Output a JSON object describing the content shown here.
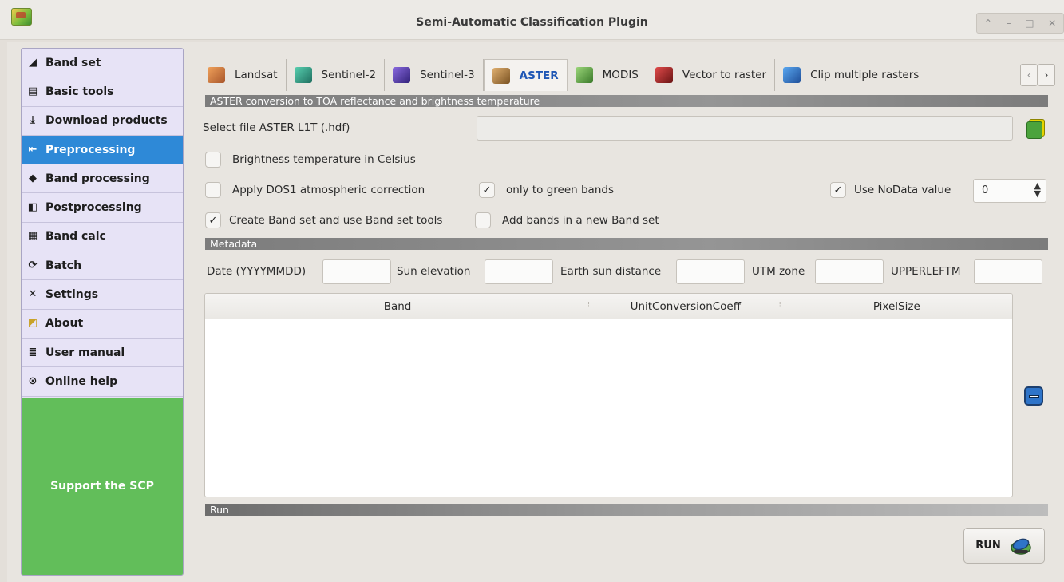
{
  "window": {
    "title": "Semi-Automatic Classification Plugin",
    "controls": [
      "⌃",
      "–",
      "□",
      "✕"
    ]
  },
  "sidebar": {
    "items": [
      {
        "label": "Band set",
        "icon": "band-set-icon"
      },
      {
        "label": "Basic tools",
        "icon": "basic-tools-icon"
      },
      {
        "label": "Download products",
        "icon": "download-icon"
      },
      {
        "label": "Preprocessing",
        "icon": "preprocessing-icon",
        "active": true
      },
      {
        "label": "Band processing",
        "icon": "band-processing-icon"
      },
      {
        "label": "Postprocessing",
        "icon": "postprocessing-icon"
      },
      {
        "label": "Band calc",
        "icon": "band-calc-icon"
      },
      {
        "label": "Batch",
        "icon": "batch-icon"
      },
      {
        "label": "Settings",
        "icon": "settings-icon"
      },
      {
        "label": "About",
        "icon": "about-icon"
      },
      {
        "label": "User manual",
        "icon": "user-manual-icon"
      },
      {
        "label": "Online help",
        "icon": "online-help-icon"
      }
    ],
    "support": "Support the SCP"
  },
  "tabs": [
    {
      "label": "Landsat",
      "color": "#d9894a"
    },
    {
      "label": "Sentinel-2",
      "color": "#3fb0a0"
    },
    {
      "label": "Sentinel-3",
      "color": "#6a4bc4"
    },
    {
      "label": "ASTER",
      "color": "#c08a4a",
      "active": true
    },
    {
      "label": "MODIS",
      "color": "#6aa84f"
    },
    {
      "label": "Vector to raster",
      "color": "#b03030"
    },
    {
      "label": "Clip multiple rasters",
      "color": "#2e7fd0"
    }
  ],
  "aster": {
    "group_title": "ASTER conversion to TOA reflectance and brightness temperature",
    "select_file_label": "Select file ASTER L1T (.hdf)",
    "file_value": "",
    "brightness_celsius": {
      "label": "Brightness temperature in Celsius",
      "checked": false
    },
    "dos1": {
      "label": "Apply DOS1 atmospheric correction",
      "checked": false
    },
    "green_bands": {
      "label": "only to green bands",
      "checked": true
    },
    "nodata": {
      "label": "Use NoData value",
      "checked": true,
      "value": "0"
    },
    "create_bandset": {
      "label": "Create Band set and use Band set tools",
      "checked": true
    },
    "add_bands": {
      "label": "Add bands in a new Band set",
      "checked": false
    }
  },
  "metadata": {
    "group_title": "Metadata",
    "date_label": "Date (YYYYMMDD)",
    "date_value": "",
    "sun_elevation_label": "Sun elevation",
    "sun_elevation_value": "",
    "earth_sun_label": "Earth sun distance",
    "earth_sun_value": "",
    "utm_label": "UTM zone",
    "utm_value": "",
    "upperleft_label": "UPPERLEFTM",
    "upperleft_value": ""
  },
  "table": {
    "columns": [
      "Band",
      "UnitConversionCoeff",
      "PixelSize"
    ],
    "rows": []
  },
  "run": {
    "group_title": "Run",
    "button_label": "RUN"
  }
}
